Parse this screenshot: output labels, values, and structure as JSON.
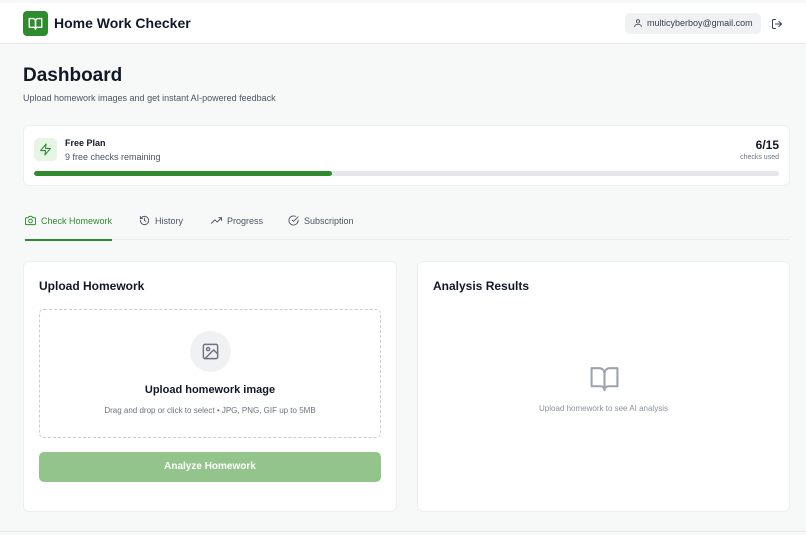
{
  "header": {
    "app_title": "Home Work Checker",
    "user_email": "multicyberboy@gmail.com",
    "icons": {
      "logo": "open-book-icon",
      "user": "user-icon",
      "logout": "logout-icon"
    }
  },
  "page": {
    "title": "Dashboard",
    "subtitle": "Upload homework images and get instant AI-powered feedback"
  },
  "plan": {
    "name": "Free Plan",
    "remaining_text": "9 free checks remaining",
    "count_text": "6/15",
    "count_label": "checks used",
    "used": 6,
    "total": 15,
    "accent_color": "#2e8b2e",
    "icon": "lightning-icon"
  },
  "tabs": [
    {
      "label": "Check Homework",
      "icon": "camera-icon",
      "active": true
    },
    {
      "label": "History",
      "icon": "history-icon",
      "active": false
    },
    {
      "label": "Progress",
      "icon": "trending-up-icon",
      "active": false
    },
    {
      "label": "Subscription",
      "icon": "check-circle-icon",
      "active": false
    }
  ],
  "upload": {
    "title": "Upload Homework",
    "dropzone_title": "Upload homework image",
    "dropzone_hint": "Drag and drop or click to select • JPG, PNG, GIF up to 5MB",
    "dropzone_icon": "image-icon",
    "analyze_label": "Analyze Homework",
    "analyze_disabled": true
  },
  "results": {
    "title": "Analysis Results",
    "empty_text": "Upload homework to see AI analysis",
    "empty_icon": "open-book-icon"
  },
  "colors": {
    "brand": "#2e8b2e",
    "button_disabled": "#93c48b",
    "background": "#f7f8f8"
  }
}
